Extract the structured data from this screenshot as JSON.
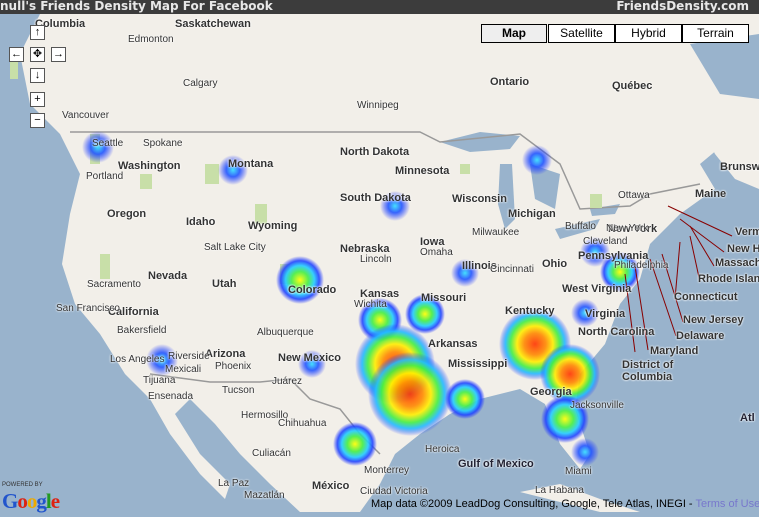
{
  "header": {
    "title": "null's Friends Density Map For Facebook",
    "site": "FriendsDensity.com"
  },
  "map_types": [
    {
      "label": "Map",
      "active": true
    },
    {
      "label": "Satellite",
      "active": false
    },
    {
      "label": "Hybrid",
      "active": false
    },
    {
      "label": "Terrain",
      "active": false
    }
  ],
  "controls": {
    "pan_up": "↑",
    "pan_left": "←",
    "reset": "✥",
    "pan_right": "→",
    "pan_down": "↓",
    "zoom_in": "+",
    "zoom_out": "−"
  },
  "labels": {
    "states": [
      "Columbia",
      "Saskatchewan",
      "Washington",
      "Montana",
      "Oregon",
      "Idaho",
      "Wyoming",
      "North Dakota",
      "South Dakota",
      "Minnesota",
      "Wisconsin",
      "Michigan",
      "Iowa",
      "Nebraska",
      "Illinois",
      "Ohio",
      "Pennsylvania",
      "New York",
      "Maine",
      "Nevada",
      "Utah",
      "Colorado",
      "Kansas",
      "Missouri",
      "Kentucky",
      "West Virginia",
      "Virginia",
      "California",
      "Arizona",
      "New Mexico",
      "Arkansas",
      "North Carolina",
      "Mississippi",
      "Georgia",
      "Ontario",
      "Québec",
      "México",
      "Brunsw",
      "Vermo",
      "New H",
      "Massach",
      "Rhode Islan",
      "Connecticut",
      "New Jersey",
      "Delaware",
      "Maryland",
      "District of",
      "Columbia"
    ],
    "cities": [
      "Edmonton",
      "Calgary",
      "Winnipeg",
      "Vancouver",
      "Seattle",
      "Spokane",
      "Portland",
      "Salt Lake City",
      "Sacramento",
      "San Francisco",
      "Bakersfield",
      "Los Angeles",
      "Riverside",
      "Mexicali",
      "Tijuana",
      "Ensenada",
      "Phoenix",
      "Tucson",
      "Albuquerque",
      "Juárez",
      "Hermosillo",
      "Chihuahua",
      "Culiacán",
      "La Paz",
      "Mazatlán",
      "Heroica",
      "Monterrey",
      "Ciudad Victoria",
      "Lincoln",
      "Omaha",
      "Wichita",
      "Milwaukee",
      "Cincinnati",
      "Buffalo",
      "Cleveland",
      "Philadelphia",
      "Ottawa",
      "New York",
      "La Habana",
      "Jacksonville",
      "Miami"
    ],
    "water": [
      "Gulf of Mexico",
      "Atl"
    ]
  },
  "hotspots": [
    {
      "area": "Seattle",
      "intensity": 0.35
    },
    {
      "area": "Montana",
      "intensity": 0.3
    },
    {
      "area": "South Dakota",
      "intensity": 0.3
    },
    {
      "area": "Michigan",
      "intensity": 0.3
    },
    {
      "area": "Colorado",
      "intensity": 0.55
    },
    {
      "area": "Missouri",
      "intensity": 0.35
    },
    {
      "area": "Los Angeles",
      "intensity": 0.35
    },
    {
      "area": "New Mexico",
      "intensity": 0.3
    },
    {
      "area": "Oklahoma",
      "intensity": 0.6
    },
    {
      "area": "Arkansas",
      "intensity": 0.5
    },
    {
      "area": "Texas North",
      "intensity": 0.9
    },
    {
      "area": "Texas Central",
      "intensity": 1.0
    },
    {
      "area": "Texas South",
      "intensity": 0.55
    },
    {
      "area": "Louisiana",
      "intensity": 0.6
    },
    {
      "area": "Alabama",
      "intensity": 0.85
    },
    {
      "area": "Georgia",
      "intensity": 0.75
    },
    {
      "area": "Florida North",
      "intensity": 0.65
    },
    {
      "area": "Miami",
      "intensity": 0.3
    },
    {
      "area": "Pennsylvania",
      "intensity": 0.35
    },
    {
      "area": "Virginia",
      "intensity": 0.6
    },
    {
      "area": "North Carolina",
      "intensity": 0.35
    }
  ],
  "footer": {
    "powered_by": "POWERED BY",
    "logo": "Google",
    "attribution": "Map data ©2009  LeadDog Consulting, Google, Tele Atlas, INEGI - ",
    "terms": "Terms of Use"
  },
  "colors": {
    "water": "#99b3cc",
    "land": "#f2efe9",
    "park": "#c8dfa8",
    "header": "#3c3c3c"
  }
}
